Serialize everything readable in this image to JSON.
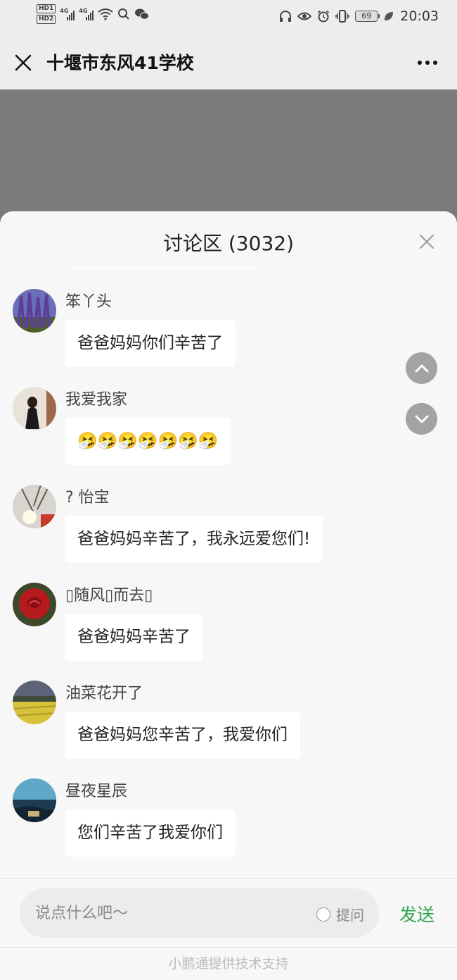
{
  "status_bar": {
    "hd1": "HD1",
    "hd2": "HD2",
    "net1": "4G",
    "net2": "4G",
    "battery": "69",
    "time": "20:03"
  },
  "nav": {
    "title": "十堰市东风41学校"
  },
  "panel": {
    "title": "讨论区 (3032)"
  },
  "comments": [
    {
      "name": "笨丫头",
      "text": "爸爸妈妈你们辛苦了"
    },
    {
      "name": "我爱我家",
      "text": "🤧🤧🤧🤧🤧🤧🤧"
    },
    {
      "name": "? 怡宝",
      "text": "爸爸妈妈辛苦了，我永远爱您们!"
    },
    {
      "name": "▯随风▯而去▯",
      "text": "爸爸妈妈辛苦了"
    },
    {
      "name": "油菜花开了",
      "text": "爸爸妈妈您辛苦了，我爱你们"
    },
    {
      "name": "昼夜星辰",
      "text": "您们辛苦了我爱你们"
    }
  ],
  "input": {
    "placeholder": "说点什么吧～",
    "ask_label": "提问",
    "send_label": "发送"
  },
  "footer": {
    "text": "小鹏通提供技术支持"
  },
  "colors": {
    "send": "#2ea44f",
    "overlay": "#7b7b7b",
    "scroll_button": "#a3a3a3"
  },
  "icons": [
    "close-icon",
    "more-icon",
    "chevron-up-icon",
    "chevron-down-icon",
    "radio-icon",
    "headphones-icon",
    "eye-icon",
    "alarm-icon",
    "vibrate-icon",
    "leaf-icon",
    "wifi-icon",
    "search-icon",
    "wechat-icon"
  ]
}
